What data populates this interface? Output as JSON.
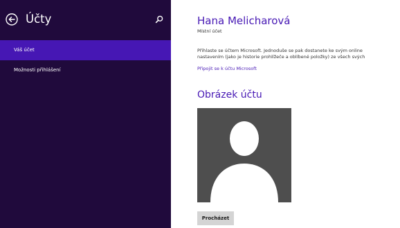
{
  "sidebar": {
    "title": "Účty",
    "items": [
      {
        "label": "Váš účet",
        "active": true
      },
      {
        "label": "Možnosti přihlášení",
        "active": false
      }
    ]
  },
  "account": {
    "name": "Hana Melicharová",
    "type": "Místní účet",
    "description_line1": "Přihlaste se účtem Microsoft. Jednoduše se pak dostanete ke svým online",
    "description_line2": "nastavením (jako je historie prohlížeče a oblíbené položky) ze všech svých",
    "connect_link": "Připojit se k účtu Microsoft"
  },
  "picture": {
    "section_title": "Obrázek účtu",
    "browse_label": "Procházet"
  },
  "colors": {
    "sidebar_bg": "#200a3c",
    "selected_item": "#4617b4",
    "accent": "#4617b4",
    "avatar_bg": "#4e4e4e"
  }
}
